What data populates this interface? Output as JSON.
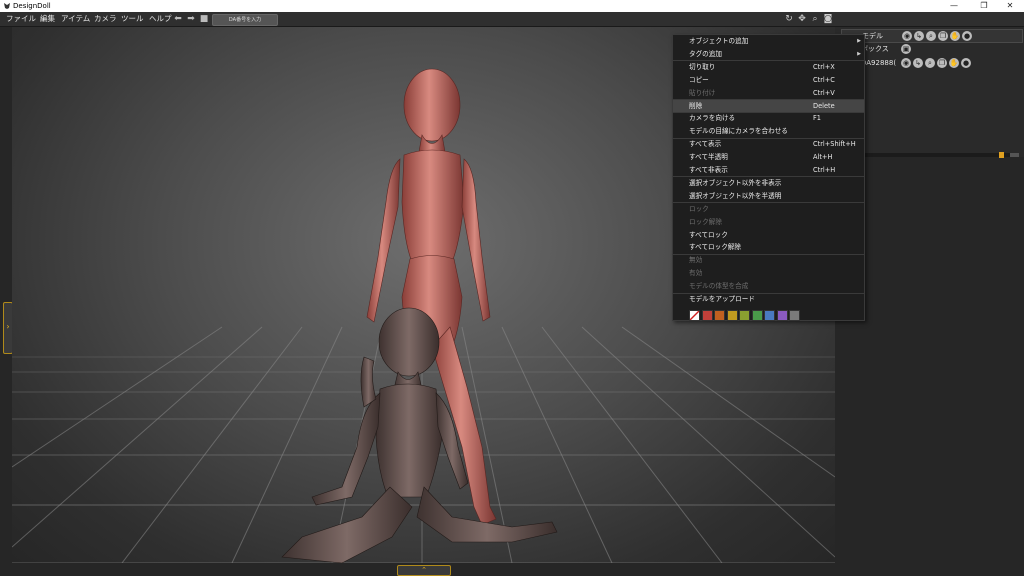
{
  "window": {
    "title": "DesignDoll",
    "controls": [
      "—",
      "❐",
      "✕"
    ]
  },
  "menubar": {
    "items": [
      "ファイル",
      "編集",
      "アイテム",
      "カメラ",
      "ツール",
      "ヘルプ"
    ],
    "search_placeholder": "DA番号を入力"
  },
  "viewport_tools": [
    "rotate-icon",
    "move-icon",
    "zoom-icon",
    "camera-icon"
  ],
  "left_panel_toggle": "›",
  "bottom_panel_toggle": "⌃",
  "scene_tree": {
    "rows": [
      {
        "label": "モデル",
        "selected": true
      },
      {
        "label": "ボックス",
        "selected": false
      },
      {
        "label": "DA92888(",
        "selected": false
      }
    ]
  },
  "context_menu": {
    "items": [
      {
        "label": "オブジェクトの追加",
        "shortcut": "",
        "submenu": true,
        "disabled": false,
        "highlight": false
      },
      {
        "label": "タグの追加",
        "shortcut": "",
        "submenu": true,
        "disabled": false,
        "highlight": false
      },
      {
        "label": "切り取り",
        "shortcut": "Ctrl+X",
        "submenu": false,
        "disabled": false,
        "highlight": false
      },
      {
        "label": "コピー",
        "shortcut": "Ctrl+C",
        "submenu": false,
        "disabled": false,
        "highlight": false
      },
      {
        "label": "貼り付け",
        "shortcut": "Ctrl+V",
        "submenu": false,
        "disabled": true,
        "highlight": false
      },
      {
        "label": "削除",
        "shortcut": "Delete",
        "submenu": false,
        "disabled": false,
        "highlight": true
      },
      {
        "label": "カメラを向ける",
        "shortcut": "F1",
        "submenu": false,
        "disabled": false,
        "highlight": false
      },
      {
        "label": "モデルの目線にカメラを合わせる",
        "shortcut": "",
        "submenu": false,
        "disabled": false,
        "highlight": false
      },
      {
        "label": "すべて表示",
        "shortcut": "Ctrl+Shift+H",
        "submenu": false,
        "disabled": false,
        "highlight": false
      },
      {
        "label": "すべて半透明",
        "shortcut": "Alt+H",
        "submenu": false,
        "disabled": false,
        "highlight": false
      },
      {
        "label": "すべて非表示",
        "shortcut": "Ctrl+H",
        "submenu": false,
        "disabled": false,
        "highlight": false
      },
      {
        "label": "選択オブジェクト以外を非表示",
        "shortcut": "",
        "submenu": false,
        "disabled": false,
        "highlight": false
      },
      {
        "label": "選択オブジェクト以外を半透明",
        "shortcut": "",
        "submenu": false,
        "disabled": false,
        "highlight": false
      },
      {
        "label": "ロック",
        "shortcut": "",
        "submenu": false,
        "disabled": true,
        "highlight": false
      },
      {
        "label": "ロック解除",
        "shortcut": "",
        "submenu": false,
        "disabled": true,
        "highlight": false
      },
      {
        "label": "すべてロック",
        "shortcut": "",
        "submenu": false,
        "disabled": false,
        "highlight": false
      },
      {
        "label": "すべてロック解除",
        "shortcut": "",
        "submenu": false,
        "disabled": false,
        "highlight": false
      },
      {
        "label": "無効",
        "shortcut": "",
        "submenu": false,
        "disabled": true,
        "highlight": false
      },
      {
        "label": "有効",
        "shortcut": "",
        "submenu": false,
        "disabled": true,
        "highlight": false
      },
      {
        "label": "モデルの体型を合成",
        "shortcut": "",
        "submenu": false,
        "disabled": true,
        "highlight": false
      },
      {
        "label": "モデルをアップロード",
        "shortcut": "",
        "submenu": false,
        "disabled": false,
        "highlight": false
      }
    ],
    "color_swatches": [
      "none",
      "#c0403a",
      "#c06020",
      "#c09a20",
      "#8aa030",
      "#4a9a4a",
      "#4a7ac0",
      "#8a5ac0",
      "#7a7a7a"
    ]
  },
  "colors": {
    "accent": "#e0a020",
    "menu_bg": "#1e1e1e",
    "model_front": "#b8645c",
    "model_back": "#5a4a46"
  }
}
